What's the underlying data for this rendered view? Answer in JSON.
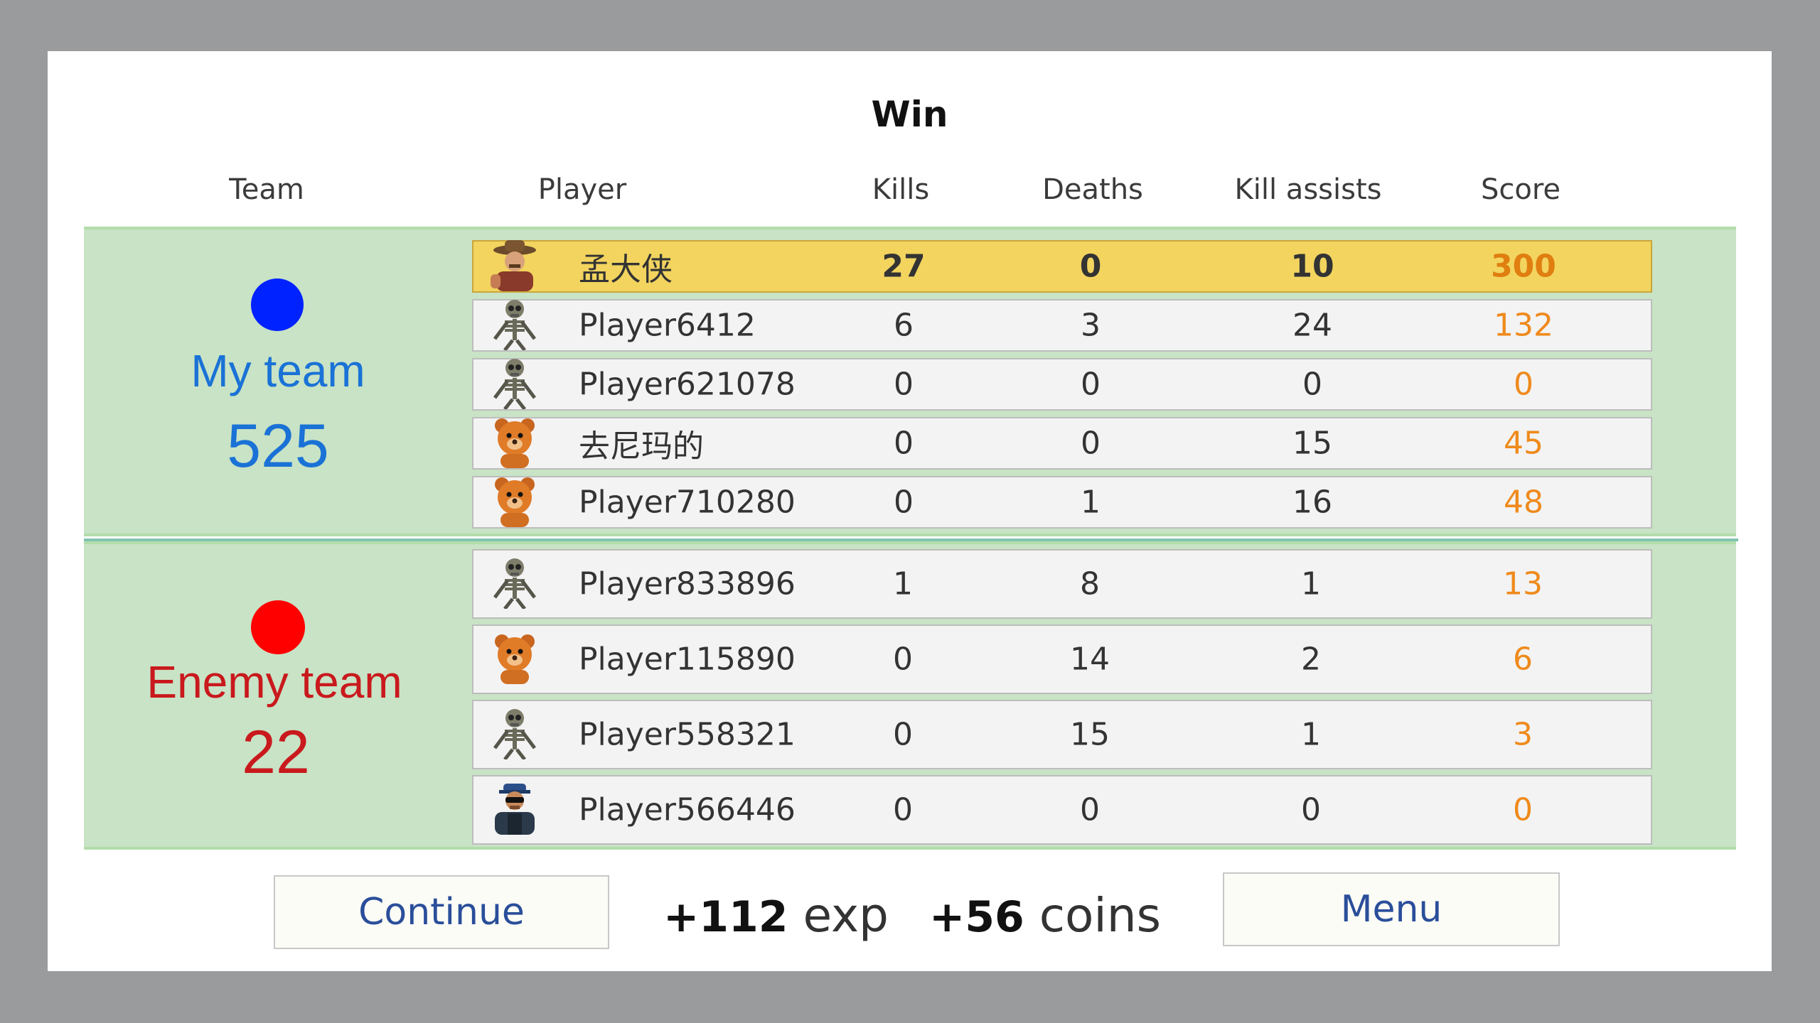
{
  "title": "Win",
  "headers": {
    "team": "Team",
    "player": "Player",
    "kills": "Kills",
    "deaths": "Deaths",
    "kill_assists": "Kill assists",
    "score": "Score"
  },
  "my_team": {
    "name": "My team",
    "score": "525",
    "color": "#0022ff",
    "label_color": "#1a72d6",
    "players": [
      {
        "avatar": "cowboy-avatar-icon",
        "name": "孟大侠",
        "kills": "27",
        "deaths": "0",
        "assists": "10",
        "score": "300",
        "highlight": true
      },
      {
        "avatar": "skeleton-avatar-icon",
        "name": "Player6412",
        "kills": "6",
        "deaths": "3",
        "assists": "24",
        "score": "132"
      },
      {
        "avatar": "skeleton-avatar-icon",
        "name": "Player621078",
        "kills": "0",
        "deaths": "0",
        "assists": "0",
        "score": "0"
      },
      {
        "avatar": "bear-avatar-icon",
        "name": "去尼玛的",
        "kills": "0",
        "deaths": "0",
        "assists": "15",
        "score": "45"
      },
      {
        "avatar": "bear-avatar-icon",
        "name": "Player710280",
        "kills": "0",
        "deaths": "1",
        "assists": "16",
        "score": "48"
      }
    ]
  },
  "enemy_team": {
    "name": "Enemy team",
    "score": "22",
    "color": "#ff0000",
    "label_color": "#c9191d",
    "players": [
      {
        "avatar": "skeleton-avatar-icon",
        "name": "Player833896",
        "kills": "1",
        "deaths": "8",
        "assists": "1",
        "score": "13"
      },
      {
        "avatar": "bear-avatar-icon",
        "name": "Player115890",
        "kills": "0",
        "deaths": "14",
        "assists": "2",
        "score": "6"
      },
      {
        "avatar": "skeleton-avatar-icon",
        "name": "Player558321",
        "kills": "0",
        "deaths": "15",
        "assists": "1",
        "score": "3"
      },
      {
        "avatar": "soldier-avatar-icon",
        "name": "Player566446",
        "kills": "0",
        "deaths": "0",
        "assists": "0",
        "score": "0"
      }
    ]
  },
  "footer": {
    "continue_label": "Continue",
    "menu_label": "Menu",
    "exp_value": "+112",
    "exp_label": "exp",
    "coins_value": "+56",
    "coins_label": "coins"
  }
}
